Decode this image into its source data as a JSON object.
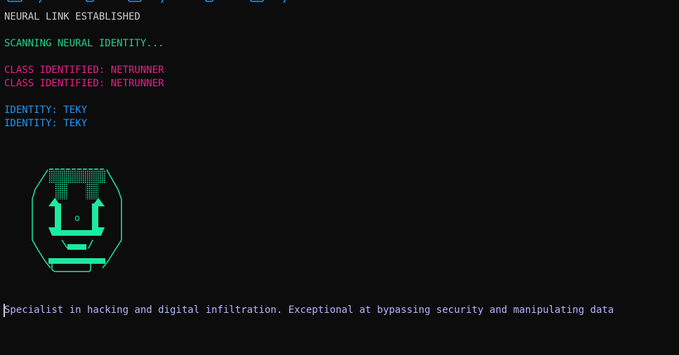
{
  "terminal": {
    "lines": {
      "link_status": "NEURAL LINK ESTABLISHED",
      "scan_status": "SCANNING NEURAL IDENTITY...",
      "class_line_1": "CLASS IDENTIFIED: NETRUNNER",
      "class_line_2": "CLASS IDENTIFIED: NETRUNNER",
      "identity_line_1": "IDENTITY: TEKY",
      "identity_line_2": "IDENTITY: TEKY",
      "description": "Specialist in hacking and digital infiltration. Exceptional at bypassing security and manipulating data"
    },
    "avatar": {
      "icon": "netrunner-ascii-avatar-icon",
      "eye_glyph": "o"
    },
    "banner": {
      "icon": "ascii-banner-fragment-icon"
    },
    "colors": {
      "background": "#0c0c0c",
      "white": "#cccccc",
      "green": "#23d18b",
      "magenta": "#e91e8c",
      "blue": "#2196f3",
      "lavender": "#b4b4ff",
      "avatar": "#1de9a0"
    }
  }
}
